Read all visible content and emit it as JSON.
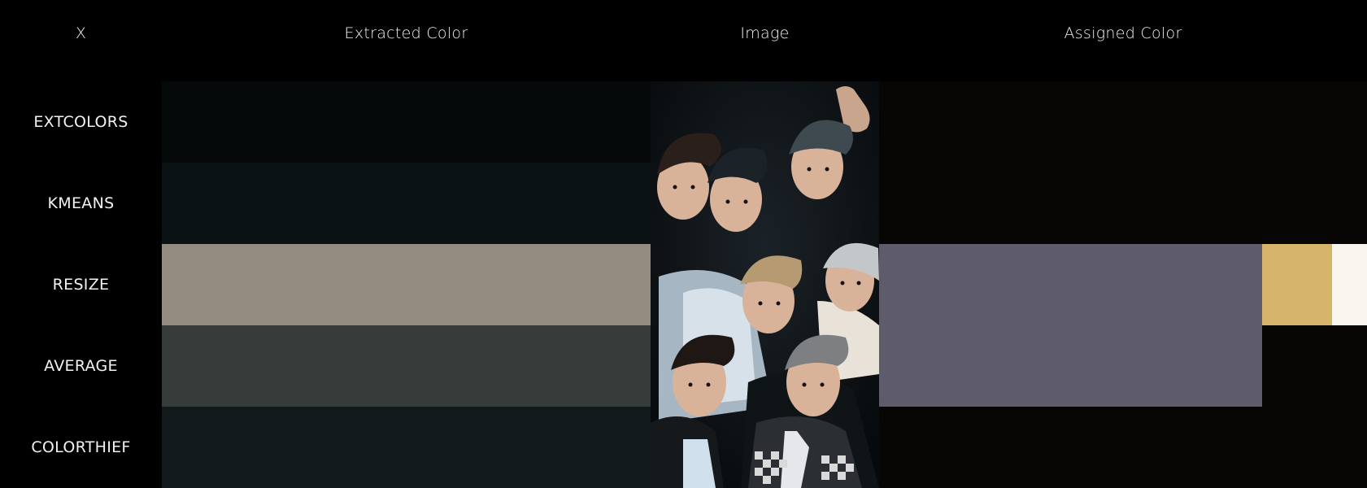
{
  "header": {
    "col_x": "X",
    "col_extracted": "Extracted Color",
    "col_image": "Image",
    "col_assigned": "Assigned Color"
  },
  "rows": [
    {
      "label": "EXTCOLORS",
      "extracted_color": "#06090a",
      "assigned_colors": [
        "#080604"
      ]
    },
    {
      "label": "KMEANS",
      "extracted_color": "#0b1213",
      "assigned_colors": [
        "#080604"
      ]
    },
    {
      "label": "RESIZE",
      "extracted_color": "#948c80",
      "assigned_colors": [
        "#5e5b6a",
        "#d6b56a",
        "#f8f6ef"
      ]
    },
    {
      "label": "AVERAGE",
      "extracted_color": "#373c3b",
      "assigned_colors": [
        "#5e5b6a",
        "#080604"
      ]
    },
    {
      "label": "COLORTHIEF",
      "extracted_color": "#131a1b",
      "assigned_colors": [
        "#080604"
      ]
    }
  ]
}
